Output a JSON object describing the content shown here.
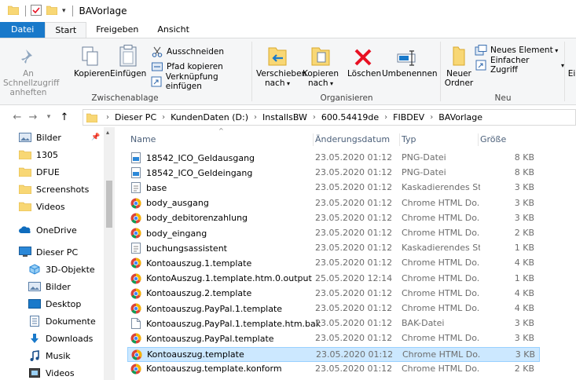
{
  "window": {
    "title": "BAVorlage"
  },
  "ribbon_tabs": [
    "Datei",
    "Start",
    "Freigeben",
    "Ansicht"
  ],
  "ribbon": {
    "clipboard": {
      "label": "Zwischenablage",
      "pin": "An Schnellzugriff anheften",
      "copy": "Kopieren",
      "paste": "Einfügen",
      "cut": "Ausschneiden",
      "copy_path": "Pfad kopieren",
      "paste_shortcut": "Verknüpfung einfügen"
    },
    "organize": {
      "label": "Organisieren",
      "move_to": "Verschieben nach",
      "copy_to": "Kopieren nach",
      "delete": "Löschen",
      "rename": "Umbenennen"
    },
    "new": {
      "label": "Neu",
      "new_folder": "Neuer Ordner",
      "new_item": "Neues Element",
      "easy_access": "Einfacher Zugriff"
    },
    "overflow": "Ei"
  },
  "address": {
    "crumbs": [
      "Dieser PC",
      "KundenDaten (D:)",
      "InstallsBW",
      "600.54419de",
      "FIBDEV",
      "BAVorlage"
    ]
  },
  "nav": {
    "items": [
      {
        "label": "Bilder",
        "icon": "pictures-folder-icon",
        "pinned": true
      },
      {
        "label": "1305",
        "icon": "folder-icon"
      },
      {
        "label": "DFUE",
        "icon": "folder-icon"
      },
      {
        "label": "Screenshots",
        "icon": "folder-icon"
      },
      {
        "label": "Videos",
        "icon": "folder-icon"
      },
      {
        "label": "OneDrive",
        "icon": "onedrive-icon"
      },
      {
        "label": "Dieser PC",
        "icon": "computer-icon"
      },
      {
        "label": "3D-Objekte",
        "icon": "3d-objects-icon"
      },
      {
        "label": "Bilder",
        "icon": "pictures-folder-icon"
      },
      {
        "label": "Desktop",
        "icon": "desktop-icon"
      },
      {
        "label": "Dokumente",
        "icon": "documents-icon"
      },
      {
        "label": "Downloads",
        "icon": "downloads-icon"
      },
      {
        "label": "Musik",
        "icon": "music-icon"
      },
      {
        "label": "Videos",
        "icon": "videos-icon"
      }
    ]
  },
  "columns": {
    "name": "Name",
    "date": "Änderungsdatum",
    "type": "Typ",
    "size": "Größe"
  },
  "files": [
    {
      "name": "18542_ICO_Geldausgang",
      "date": "23.05.2020 01:12",
      "type": "PNG-Datei",
      "size": "8 KB",
      "icon": "png-file-icon"
    },
    {
      "name": "18542_ICO_Geldeingang",
      "date": "23.05.2020 01:12",
      "type": "PNG-Datei",
      "size": "8 KB",
      "icon": "png-file-icon"
    },
    {
      "name": "base",
      "date": "23.05.2020 01:12",
      "type": "Kaskadierendes St...",
      "size": "3 KB",
      "icon": "css-file-icon"
    },
    {
      "name": "body_ausgang",
      "date": "23.05.2020 01:12",
      "type": "Chrome HTML Do...",
      "size": "3 KB",
      "icon": "chrome-html-icon"
    },
    {
      "name": "body_debitorenzahlung",
      "date": "23.05.2020 01:12",
      "type": "Chrome HTML Do...",
      "size": "3 KB",
      "icon": "chrome-html-icon"
    },
    {
      "name": "body_eingang",
      "date": "23.05.2020 01:12",
      "type": "Chrome HTML Do...",
      "size": "2 KB",
      "icon": "chrome-html-icon"
    },
    {
      "name": "buchungsassistent",
      "date": "23.05.2020 01:12",
      "type": "Kaskadierendes St...",
      "size": "1 KB",
      "icon": "css-file-icon"
    },
    {
      "name": "Kontoauszug.1.template",
      "date": "23.05.2020 01:12",
      "type": "Chrome HTML Do...",
      "size": "4 KB",
      "icon": "chrome-html-icon"
    },
    {
      "name": "KontoAuszug.1.template.htm.0.output",
      "date": "25.05.2020 12:14",
      "type": "Chrome HTML Do...",
      "size": "1 KB",
      "icon": "chrome-html-icon"
    },
    {
      "name": "Kontoauszug.2.template",
      "date": "23.05.2020 01:12",
      "type": "Chrome HTML Do...",
      "size": "4 KB",
      "icon": "chrome-html-icon"
    },
    {
      "name": "Kontoauszug.PayPal.1.template",
      "date": "23.05.2020 01:12",
      "type": "Chrome HTML Do...",
      "size": "4 KB",
      "icon": "chrome-html-icon"
    },
    {
      "name": "Kontoauszug.PayPal.1.template.htm.bak",
      "date": "23.05.2020 01:12",
      "type": "BAK-Datei",
      "size": "3 KB",
      "icon": "bak-file-icon"
    },
    {
      "name": "Kontoauszug.PayPal.template",
      "date": "23.05.2020 01:12",
      "type": "Chrome HTML Do...",
      "size": "3 KB",
      "icon": "chrome-html-icon"
    },
    {
      "name": "Kontoauszug.template",
      "date": "23.05.2020 01:12",
      "type": "Chrome HTML Do...",
      "size": "3 KB",
      "icon": "chrome-html-icon",
      "selected": true
    },
    {
      "name": "Kontoauszug.template.konform",
      "date": "23.05.2020 01:12",
      "type": "Chrome HTML Do...",
      "size": "2 KB",
      "icon": "chrome-html-icon"
    }
  ],
  "colors": {
    "accent": "#1979ca",
    "selection": "#cce8ff",
    "folder": "#f8d775",
    "delete_red": "#e81123"
  }
}
